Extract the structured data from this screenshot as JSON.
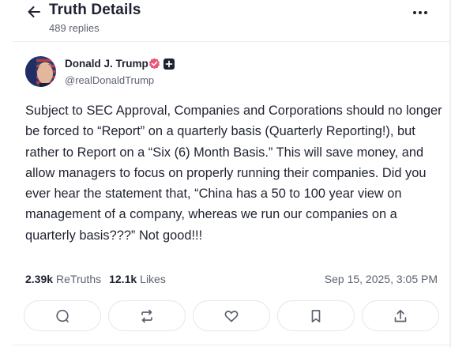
{
  "header": {
    "title": "Truth Details",
    "replies": "489 replies"
  },
  "author": {
    "name": "Donald J. Trump",
    "handle": "@realDonaldTrump"
  },
  "post": {
    "text": "Subject to SEC Approval, Companies and Corporations should no longer be forced to “Report” on a quarterly basis (Quarterly Reporting!), but rather to Report on a “Six (6) Month Basis.” This will save money, and allow managers to focus on properly running their companies. Did you ever hear the statement that, “China has a 50 to 100 year view on management of a company, whereas we run our companies on a quarterly basis???” Not good!!!"
  },
  "stats": {
    "retruths_count": "2.39k",
    "retruths_label": "ReTruths",
    "likes_count": "12.1k",
    "likes_label": "Likes",
    "timestamp": "Sep 15, 2025, 3:05 PM"
  },
  "colors": {
    "verified_badge": "#e8577a",
    "text_primary": "#1e2230",
    "text_secondary": "#5c6270",
    "border": "#e4e6eb"
  },
  "icons": [
    "back-arrow-icon",
    "more-dots-icon",
    "verified-icon",
    "plus-icon",
    "reply-icon",
    "retruth-icon",
    "like-icon",
    "bookmark-icon",
    "share-icon"
  ]
}
